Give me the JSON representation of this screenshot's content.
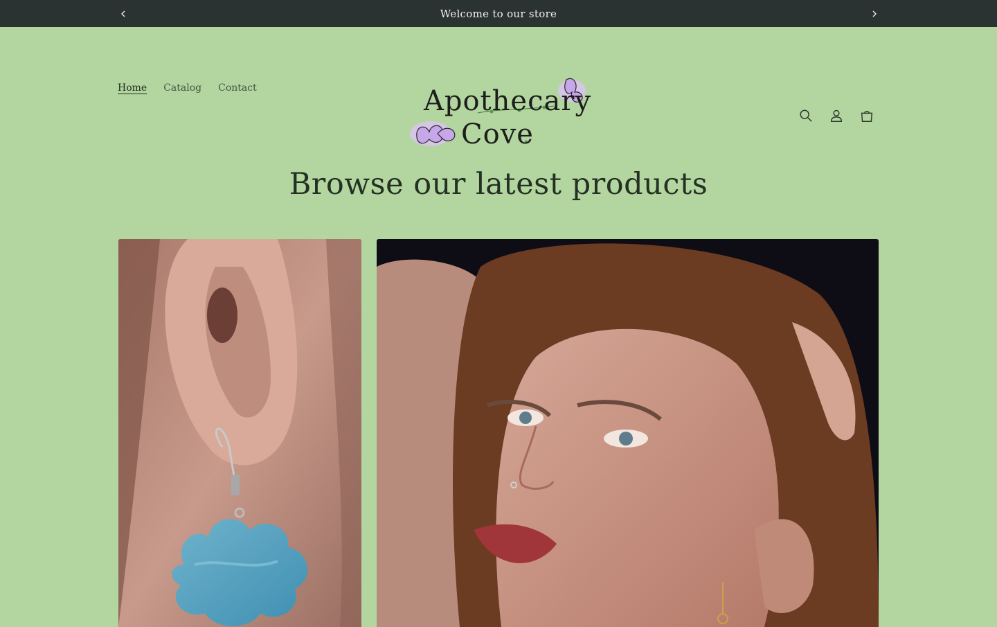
{
  "announcement": {
    "text": "Welcome to our store",
    "prev_icon": "chevron-left-icon",
    "next_icon": "chevron-right-icon"
  },
  "header": {
    "nav": [
      {
        "label": "Home",
        "active": true
      },
      {
        "label": "Catalog",
        "active": false
      },
      {
        "label": "Contact",
        "active": false
      }
    ],
    "logo": {
      "line1": "Apothecary",
      "line2": "Cove"
    },
    "icons": [
      "search-icon",
      "account-icon",
      "cart-icon"
    ]
  },
  "main": {
    "heading": "Browse our latest products",
    "products": [
      {
        "image": "model-ear-cloud-earring-photo"
      },
      {
        "image": "model-portrait-earring-photo"
      }
    ]
  },
  "colors": {
    "background": "#b3d59f",
    "announcement_bar": "#2b3232",
    "text": "#2e3a2f"
  }
}
